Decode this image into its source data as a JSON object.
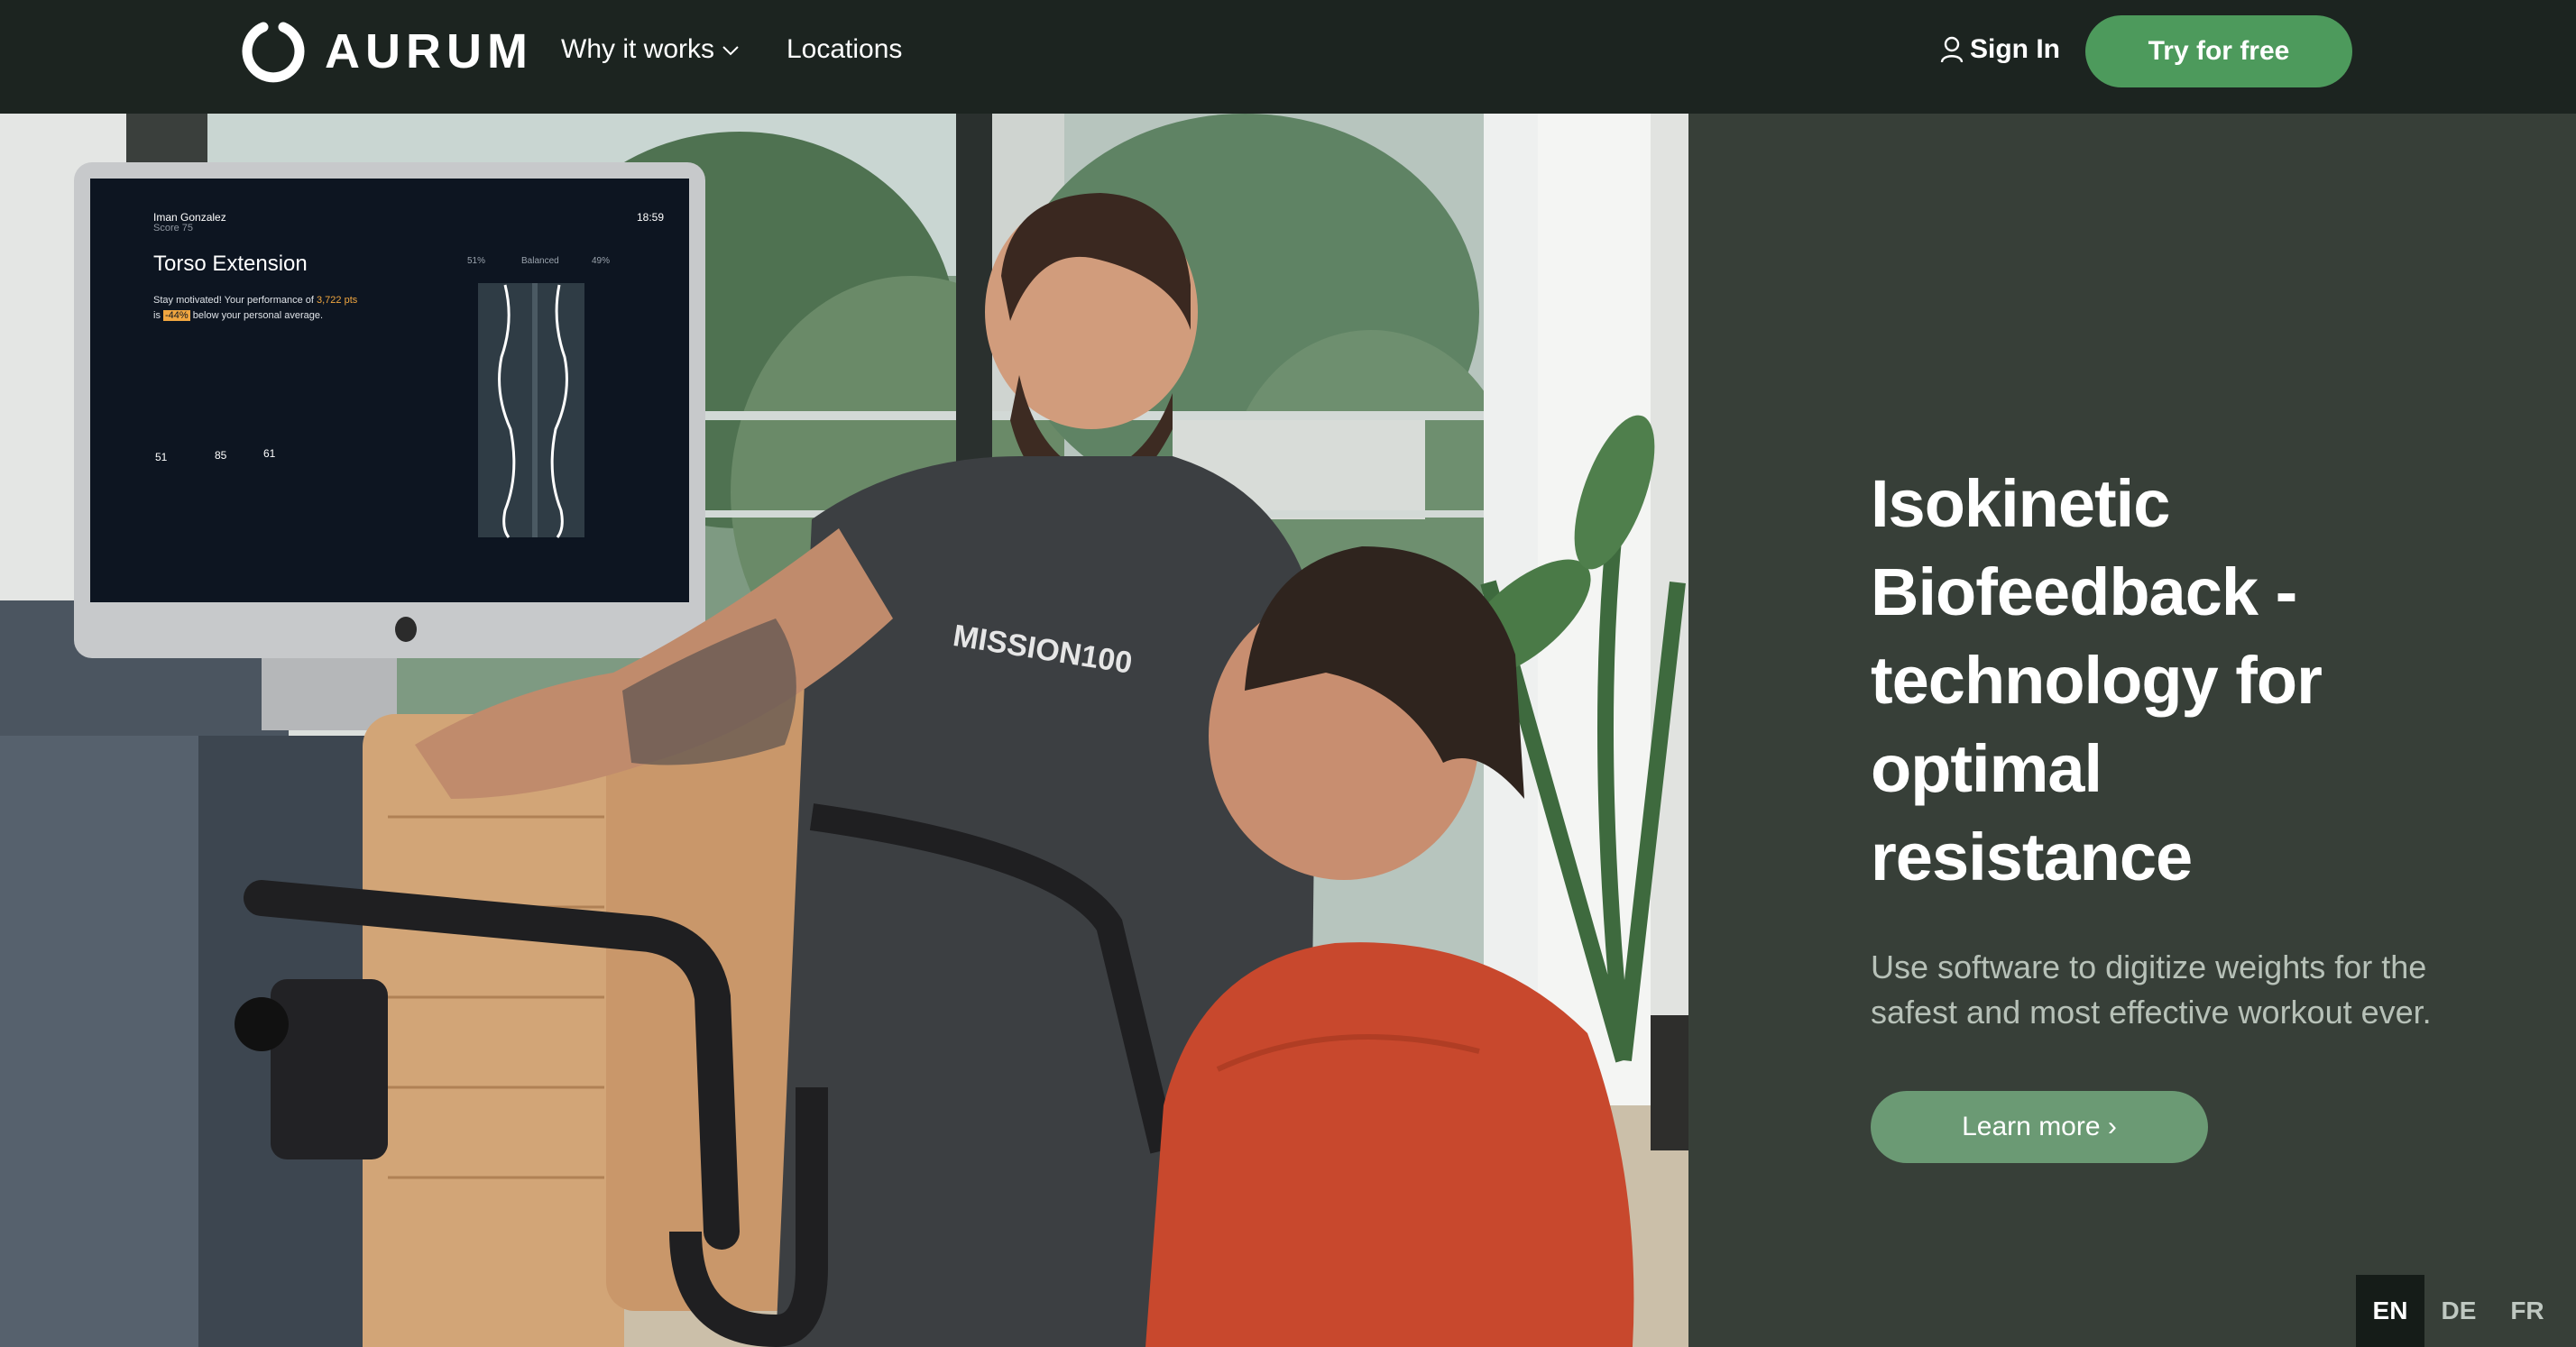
{
  "nav": {
    "logo_text": "AURUM",
    "links": [
      {
        "label": "Why it works"
      },
      {
        "label": "Locations"
      }
    ],
    "sign_in": "Sign In",
    "cta": "Try for free"
  },
  "hero": {
    "title": "Isokinetic Biofeedback - technology for optimal resistance",
    "subtitle": "Use software to digitize weights for the safest and most effective workout ever.",
    "button": "Learn more ›"
  },
  "photo": {
    "monitor": {
      "user_name": "Iman Gonzalez",
      "user_score": "Score 75",
      "time": "18:59",
      "exercise": "Torso Extension",
      "message_line1": "Stay motivated! Your performance of",
      "message_points": "3,722 pts",
      "message_line2_pre": "is",
      "message_pct": "-44%",
      "message_line2_post": "below your personal average.",
      "left_pct": "51%",
      "balance_label": "Balanced",
      "right_pct": "49%",
      "stats": [
        "51",
        "85",
        "61"
      ]
    },
    "shirt_text": "MISSION100"
  },
  "languages": [
    "EN",
    "DE",
    "FR"
  ],
  "colors": {
    "nav_bg": "#1c2420",
    "panel_bg": "#373f38",
    "cta_green": "#4d9a5c",
    "learn_green": "#6b9a74"
  }
}
